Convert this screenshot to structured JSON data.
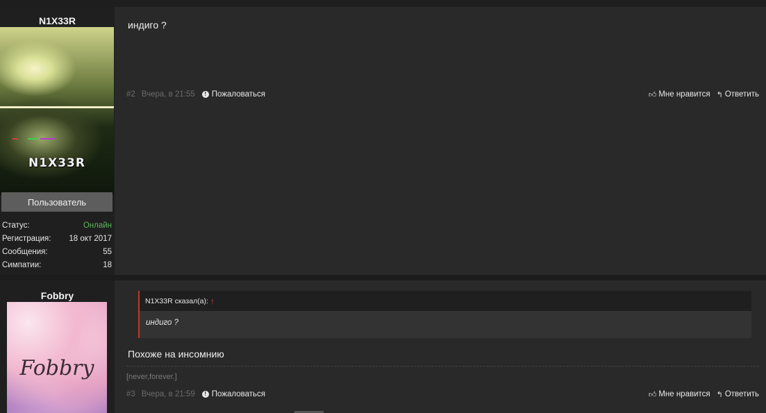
{
  "posts": [
    {
      "author": "N1X33R",
      "avatar_text": "N1X33R",
      "role": "Пользователь",
      "stats": [
        {
          "label": "Статус:",
          "value": "Онлайн"
        },
        {
          "label": "Регистрация:",
          "value": "18 окт 2017"
        },
        {
          "label": "Сообщения:",
          "value": "55"
        },
        {
          "label": "Симпатии:",
          "value": "18"
        }
      ],
      "message": "индиго ?",
      "number": "#2",
      "date": "Вчера, в 21:55",
      "report": "Пожаловаться",
      "like": "Мне нравится",
      "reply": "Ответить"
    },
    {
      "author": "Fobbry",
      "avatar_text": "Fobbry",
      "quote": {
        "author_line": "N1X33R сказал(а):",
        "text": "индиго ?"
      },
      "message": "Похоже на инсомнию",
      "signature": "[never,forever.]",
      "number": "#3",
      "date": "Вчера, в 21:59",
      "report": "Пожаловаться",
      "like": "Мне нравится",
      "reply": "Ответить"
    }
  ],
  "colors": {
    "online": "#5cb85c",
    "quote_accent": "#c0392b"
  },
  "icons": [
    "info-icon",
    "thumbs-up-icon",
    "reply-icon",
    "arrow-up-icon"
  ]
}
